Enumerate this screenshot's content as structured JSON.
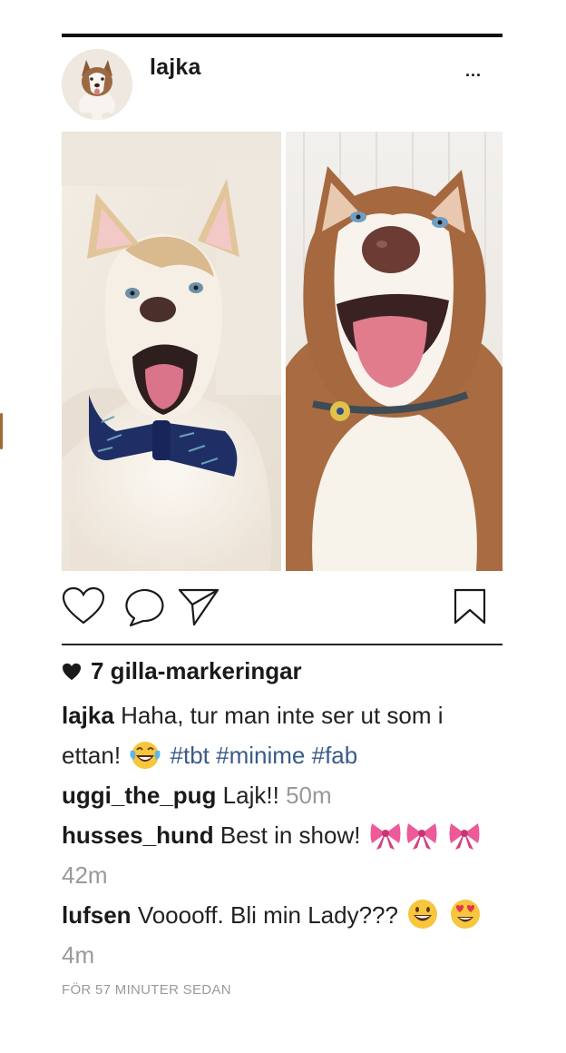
{
  "post": {
    "username": "lajka",
    "more_label": "...",
    "likes_label": "7 gilla-markeringar",
    "timestamp": "FÖR 57 MINUTER SEDAN"
  },
  "caption": {
    "author": "lajka",
    "text": "Haha, tur man inte ser ut som i ettan!",
    "emoji": "face-with-tears-of-joy",
    "tags": [
      "#tbt",
      "#minime",
      "#fab"
    ]
  },
  "comments": [
    {
      "author": "uggi_the_pug",
      "text": "Lajk!!",
      "emojis": [],
      "time": "50m"
    },
    {
      "author": "husses_hund",
      "text": "Best in show!",
      "emojis": [
        "ribbon-bow",
        "ribbon-bow",
        "ribbon-bow"
      ],
      "time": "42m"
    },
    {
      "author": "lufsen",
      "text": "Vooooff. Bli min Lady???",
      "emojis": [
        "grinning-face",
        "heart-eyes-face"
      ],
      "time": "4m"
    }
  ],
  "icons": {
    "like": "heart-outline-icon",
    "comment": "speech-bubble-icon",
    "share": "paper-plane-icon",
    "save": "bookmark-icon",
    "likes": "heart-filled-icon"
  },
  "colors": {
    "hashtag": "#3a5b8a",
    "muted": "#999999",
    "text": "#1a1a1a"
  }
}
